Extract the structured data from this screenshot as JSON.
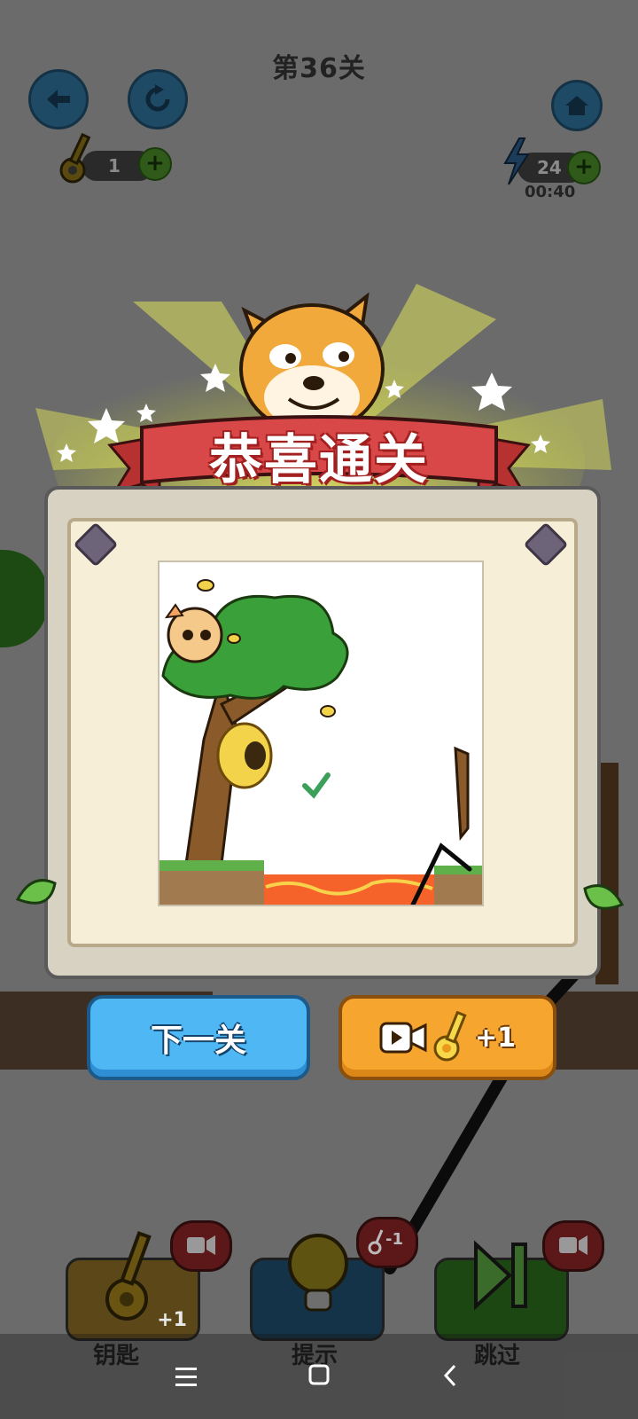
{
  "hud": {
    "level_title": "第36关",
    "keys_count": "1",
    "energy_count": "24",
    "energy_timer": "00:40",
    "back_icon": "back-arrow-icon",
    "restart_icon": "restart-icon",
    "home_icon": "home-icon"
  },
  "tools": {
    "key": {
      "label": "钥匙",
      "badge": "+1"
    },
    "hint": {
      "label": "提示",
      "badge": "-1"
    },
    "skip": {
      "label": "跳过"
    }
  },
  "dialog": {
    "banner": "恭喜通关",
    "next_button": "下一关",
    "video_reward": "+1"
  },
  "colors": {
    "next_button": "#4fb7f3",
    "video_button": "#f6a62e",
    "banner_ribbon": "#d94848",
    "lava": "#f5622a"
  }
}
